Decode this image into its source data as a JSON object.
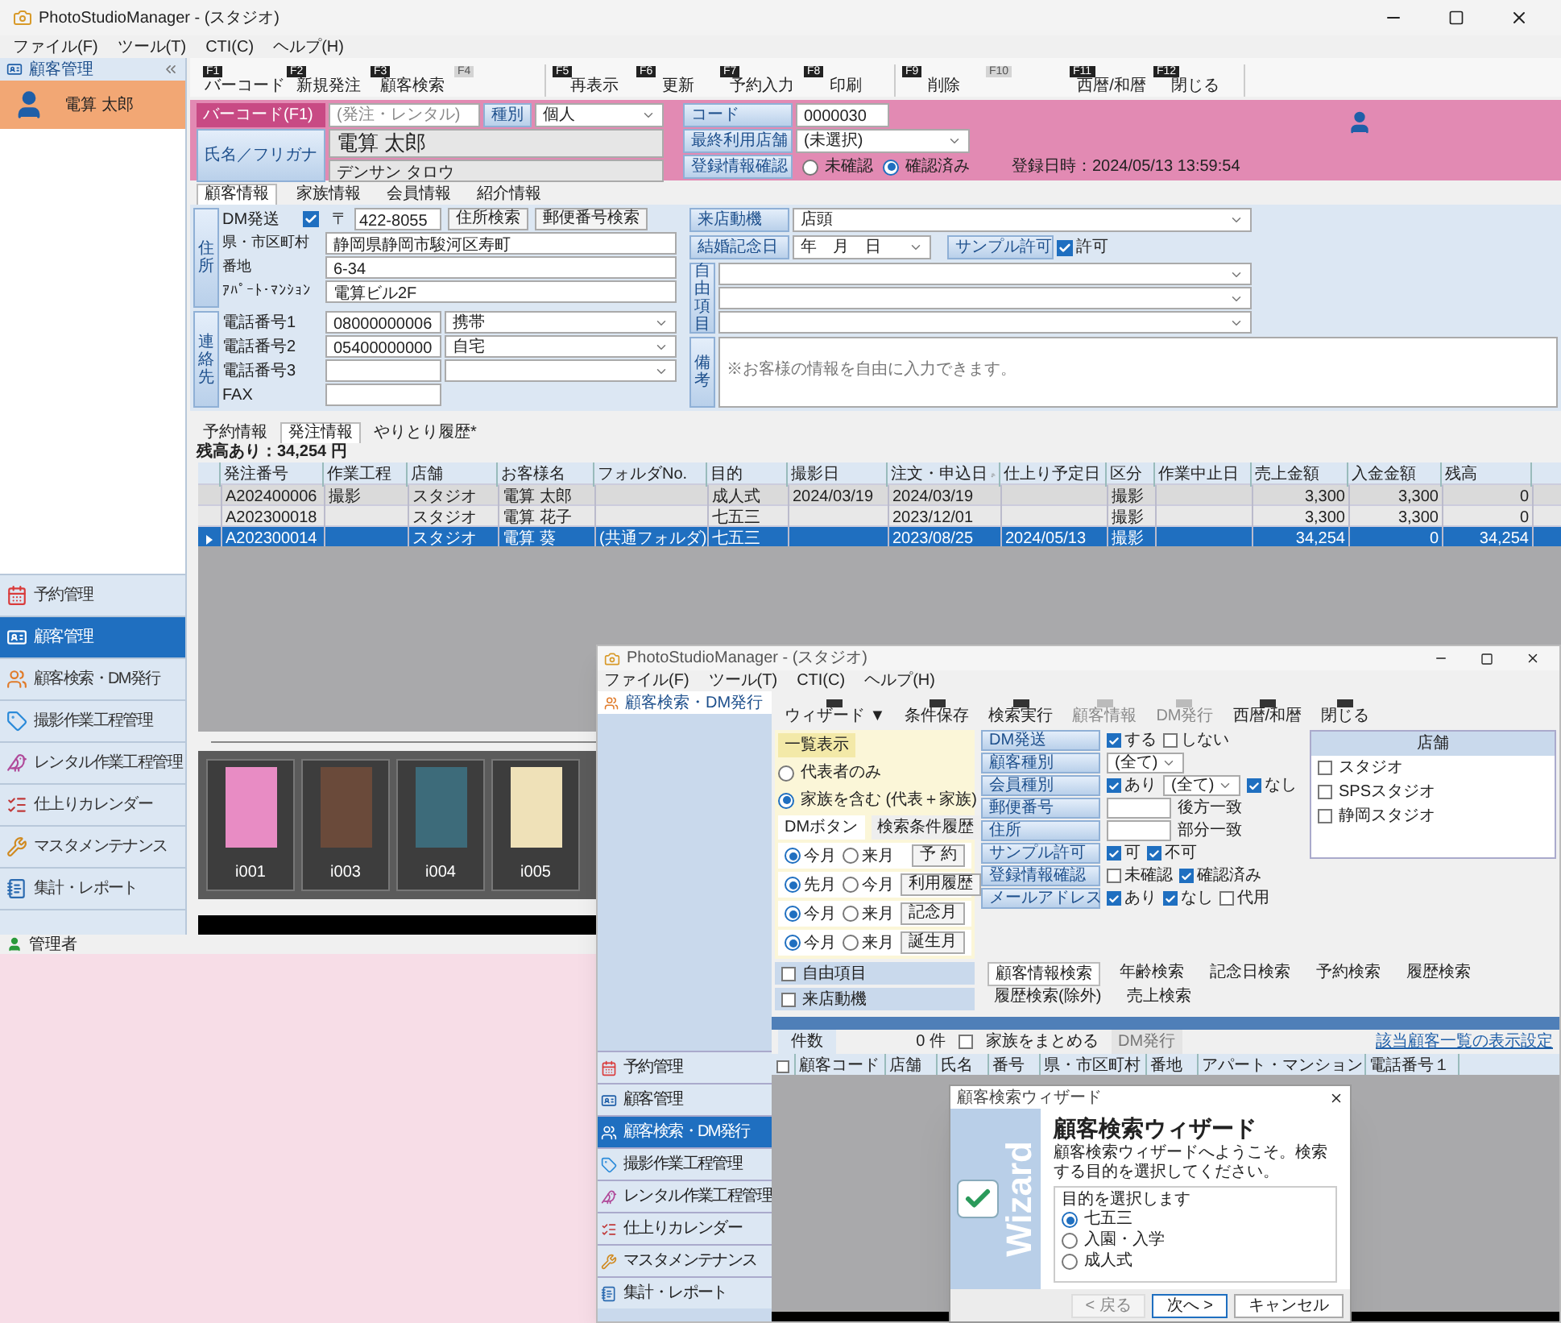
{
  "window": {
    "title": "PhotoStudioManager - (スタジオ)",
    "menu": [
      "ファイル(F)",
      "ツール(T)",
      "CTI(C)",
      "ヘルプ(H)"
    ]
  },
  "sidebar": {
    "header": "顧客管理",
    "customer": "電算 太郎",
    "nav": [
      {
        "label": "予約管理",
        "selected": false
      },
      {
        "label": "顧客管理",
        "selected": true
      },
      {
        "label": "顧客検索・DM発行",
        "selected": false
      },
      {
        "label": "撮影作業工程管理",
        "selected": false
      },
      {
        "label": "レンタル作業工程管理",
        "selected": false
      },
      {
        "label": "仕上りカレンダー",
        "selected": false
      },
      {
        "label": "マスタメンテナンス",
        "selected": false
      },
      {
        "label": "集計・レポート",
        "selected": false
      }
    ],
    "user": "管理者"
  },
  "toolbar": [
    {
      "key": "F1",
      "label": "バーコード",
      "disabled": false
    },
    {
      "key": "F2",
      "label": "新規発注",
      "disabled": false
    },
    {
      "key": "F3",
      "label": "顧客検索",
      "disabled": false
    },
    {
      "key": "F4",
      "disabled": true
    },
    {
      "key": "F5",
      "label": "再表示",
      "disabled": false
    },
    {
      "key": "F6",
      "label": "更新",
      "disabled": false
    },
    {
      "key": "F7",
      "label": "予約入力",
      "disabled": false
    },
    {
      "key": "F8",
      "label": "印刷",
      "disabled": false
    },
    {
      "key": "F9",
      "label": "削除",
      "disabled": false
    },
    {
      "key": "F10",
      "disabled": true
    },
    {
      "key": "F11",
      "label": "西暦/和暦",
      "disabled": false
    },
    {
      "key": "F12",
      "label": "閉じる",
      "disabled": false
    }
  ],
  "header": {
    "barcode_label": "バーコード(F1)",
    "barcode_placeholder": "(発注・レンタル)",
    "type_label": "種別",
    "type_value": "個人",
    "name_label": "氏名／フリガナ",
    "name": "電算 太郎",
    "kana": "デンサン タロウ",
    "code_label": "コード",
    "code": "0000030",
    "store_label": "最終利用店舗",
    "store": "(未選択)",
    "confirm_label": "登録情報確認",
    "confirm_options": [
      {
        "label": "未確認",
        "selected": false
      },
      {
        "label": "確認済み",
        "selected": true
      }
    ],
    "registered": "登録日時：2024/05/13 13:59:54"
  },
  "customer_tabs": [
    {
      "label": "顧客情報",
      "selected": true
    },
    {
      "label": "家族情報",
      "selected": false
    },
    {
      "label": "会員情報",
      "selected": false
    },
    {
      "label": "紹介情報",
      "selected": false
    }
  ],
  "address": {
    "group_label": "住所",
    "dm_label": "DM発送",
    "dm_checked": true,
    "postal_mark": "〒",
    "postal": "422-8055",
    "buttons": [
      "住所検索",
      "郵便番号検索"
    ],
    "fields": [
      {
        "label": "県・市区町村",
        "value": "静岡県静岡市駿河区寿町"
      },
      {
        "label": "番地",
        "value": "6-34"
      },
      {
        "label": "ｱﾊﾟｰﾄ･ﾏﾝｼｮﾝ",
        "value": "電算ビル2F"
      }
    ]
  },
  "contact": {
    "group_label": "連絡先",
    "phones": [
      {
        "label": "電話番号1",
        "value": "08000000006",
        "type": "携帯"
      },
      {
        "label": "電話番号2",
        "value": "05400000000",
        "type": "自宅"
      },
      {
        "label": "電話番号3"
      }
    ],
    "fax_label": "FAX"
  },
  "details": {
    "visit_label": "来店動機",
    "visit": "店頭",
    "anniversary_label": "結婚記念日",
    "anniversary": "年　月　日",
    "sample_label": "サンプル許可",
    "sample_checked": true,
    "sample_text": "許可",
    "free_label": "自由項目",
    "note_label": "備考",
    "note_placeholder": "※お客様の情報を自由に入力できます。"
  },
  "order_tabs": [
    {
      "label": "予約情報",
      "selected": false
    },
    {
      "label": "発注情報",
      "selected": true
    },
    {
      "label": "やりとり履歴*",
      "selected": false
    }
  ],
  "balance": "残高あり：34,254 円",
  "orders": {
    "columns": [
      "発注番号",
      "作業工程",
      "店舗",
      "お客様名",
      "フォルダNo.",
      "目的",
      "撮影日",
      "注文・申込日",
      "仕上り予定日",
      "区分",
      "作業中止日",
      "売上金額",
      "入金金額",
      "残高"
    ],
    "rows": [
      {
        "selected": false,
        "cells": [
          "A202400006",
          "撮影",
          "スタジオ",
          "電算 太郎",
          null,
          "成人式",
          "2024/03/19",
          "2024/03/19",
          null,
          "撮影",
          null,
          "3,300",
          "3,300",
          "0"
        ]
      },
      {
        "selected": false,
        "cells": [
          "A202300018",
          null,
          "スタジオ",
          "電算 花子",
          null,
          "七五三",
          null,
          "2023/12/01",
          null,
          "撮影",
          null,
          "3,300",
          "3,300",
          "0"
        ]
      },
      {
        "selected": true,
        "cells": [
          "A202300014",
          null,
          "スタジオ",
          "電算 葵",
          "(共通フォルダ)",
          "七五三",
          null,
          "2023/08/25",
          "2024/05/13",
          "撮影",
          null,
          "34,254",
          "0",
          "34,254"
        ]
      }
    ]
  },
  "thumbnails": [
    "i001",
    "i003",
    "i004",
    "i005"
  ],
  "search_window": {
    "title": "PhotoStudioManager - (スタジオ)",
    "menu": [
      "ファイル(F)",
      "ツール(T)",
      "CTI(C)",
      "ヘルプ(H)"
    ],
    "sidebar_header": "顧客検索・DM発行",
    "nav": [
      {
        "label": "予約管理",
        "selected": false
      },
      {
        "label": "顧客管理",
        "selected": false
      },
      {
        "label": "顧客検索・DM発行",
        "selected": true
      },
      {
        "label": "撮影作業工程管理",
        "selected": false
      },
      {
        "label": "レンタル作業工程管理",
        "selected": false
      },
      {
        "label": "仕上りカレンダー",
        "selected": false
      },
      {
        "label": "マスタメンテナンス",
        "selected": false
      },
      {
        "label": "集計・レポート",
        "selected": false
      }
    ],
    "toolbar": [
      {
        "label": "ウィザード ▼",
        "disabled": false
      },
      {
        "label": "条件保存",
        "disabled": false
      },
      {
        "label": "検索実行",
        "disabled": false
      },
      {
        "label": "顧客情報",
        "disabled": true
      },
      {
        "label": "DM発行",
        "disabled": true
      },
      {
        "label": "西暦/和暦",
        "disabled": false
      },
      {
        "label": "閉じる",
        "disabled": false
      }
    ],
    "list_label": "一覧表示",
    "list_options": [
      {
        "label": "代表者のみ",
        "selected": false
      },
      {
        "label": "家族を含む (代表＋家族)",
        "selected": true
      }
    ],
    "left_tabs": [
      {
        "label": "DMボタン",
        "selected": true
      },
      {
        "label": "検索条件履歴",
        "selected": false
      }
    ],
    "month_rows": [
      {
        "options": [
          {
            "label": "今月",
            "selected": true
          },
          {
            "label": "来月",
            "selected": false
          }
        ],
        "button": "予 約"
      },
      {
        "options": [
          {
            "label": "先月",
            "selected": true
          },
          {
            "label": "今月",
            "selected": false
          }
        ],
        "button": "利用履歴"
      },
      {
        "options": [
          {
            "label": "今月",
            "selected": true
          },
          {
            "label": "来月",
            "selected": false
          }
        ],
        "button": "記念月"
      },
      {
        "options": [
          {
            "label": "今月",
            "selected": true
          },
          {
            "label": "来月",
            "selected": false
          }
        ],
        "button": "誕生月"
      }
    ],
    "criteria": [
      {
        "label": "DM発送",
        "items": [
          {
            "kind": "check",
            "label": "する",
            "checked": true
          },
          {
            "kind": "check",
            "label": "しない",
            "checked": false
          }
        ]
      },
      {
        "label": "顧客種別",
        "items": [
          {
            "kind": "select",
            "value": "(全て)"
          }
        ]
      },
      {
        "label": "会員種別",
        "items": [
          {
            "kind": "check",
            "label": "あり",
            "checked": true
          },
          {
            "kind": "select",
            "value": "(全て)"
          },
          {
            "kind": "check",
            "label": "なし",
            "checked": true
          }
        ]
      },
      {
        "label": "郵便番号",
        "items": [
          {
            "kind": "input"
          },
          {
            "kind": "text",
            "label": "後方一致"
          }
        ]
      },
      {
        "label": "住所",
        "items": [
          {
            "kind": "input"
          },
          {
            "kind": "text",
            "label": "部分一致"
          }
        ]
      },
      {
        "label": "サンプル許可",
        "items": [
          {
            "kind": "check",
            "label": "可",
            "checked": true
          },
          {
            "kind": "check",
            "label": "不可",
            "checked": true
          }
        ]
      },
      {
        "label": "登録情報確認",
        "items": [
          {
            "kind": "check",
            "label": "未確認",
            "checked": false
          },
          {
            "kind": "check",
            "label": "確認済み",
            "checked": true
          }
        ]
      },
      {
        "label": "メールアドレス",
        "items": [
          {
            "kind": "check",
            "label": "あり",
            "checked": true
          },
          {
            "kind": "check",
            "label": "なし",
            "checked": true
          },
          {
            "kind": "check",
            "label": "代用",
            "checked": false
          }
        ]
      }
    ],
    "store_header": "店舗",
    "stores": [
      {
        "label": "スタジオ",
        "checked": false
      },
      {
        "label": "SPSスタジオ",
        "checked": false
      },
      {
        "label": "静岡スタジオ",
        "checked": false
      }
    ],
    "search_tabs": [
      {
        "label": "顧客情報検索",
        "selected": true
      },
      {
        "label": "年齢検索",
        "selected": false
      },
      {
        "label": "記念日検索",
        "selected": false
      },
      {
        "label": "予約検索",
        "selected": false
      },
      {
        "label": "履歴検索",
        "selected": false
      },
      {
        "label": "履歴検索(除外)",
        "selected": false
      },
      {
        "label": "売上検索",
        "selected": false
      }
    ],
    "extra_checks": [
      {
        "label": "自由項目",
        "checked": false
      },
      {
        "label": "来店動機",
        "checked": false
      }
    ],
    "count_label": "件数",
    "count": "0 件",
    "family_label": "家族をまとめる",
    "family_checked": false,
    "dm_button": "DM発行",
    "settings_link": "該当顧客一覧の表示設定",
    "select_all_checked": false,
    "columns": [
      "顧客コード",
      "店舗",
      "氏名",
      "番号",
      "県・市区町村",
      "番地",
      "アパート・マンション",
      "電話番号１"
    ],
    "wizard": {
      "title": "顧客検索ウィザード",
      "side_text": "Wizard",
      "heading": "顧客検索ウィザード",
      "intro": "顧客検索ウィザードへようこそ。検索する目的を選択してください。",
      "group_label": "目的を選択します",
      "options": [
        {
          "label": "七五三",
          "selected": true
        },
        {
          "label": "入園・入学",
          "selected": false
        },
        {
          "label": "成人式",
          "selected": false
        }
      ],
      "buttons": [
        {
          "label": "< 戻る",
          "disabled": true
        },
        {
          "label": "次へ >",
          "disabled": false
        },
        {
          "label": "キャンセル",
          "disabled": false
        }
      ]
    }
  }
}
